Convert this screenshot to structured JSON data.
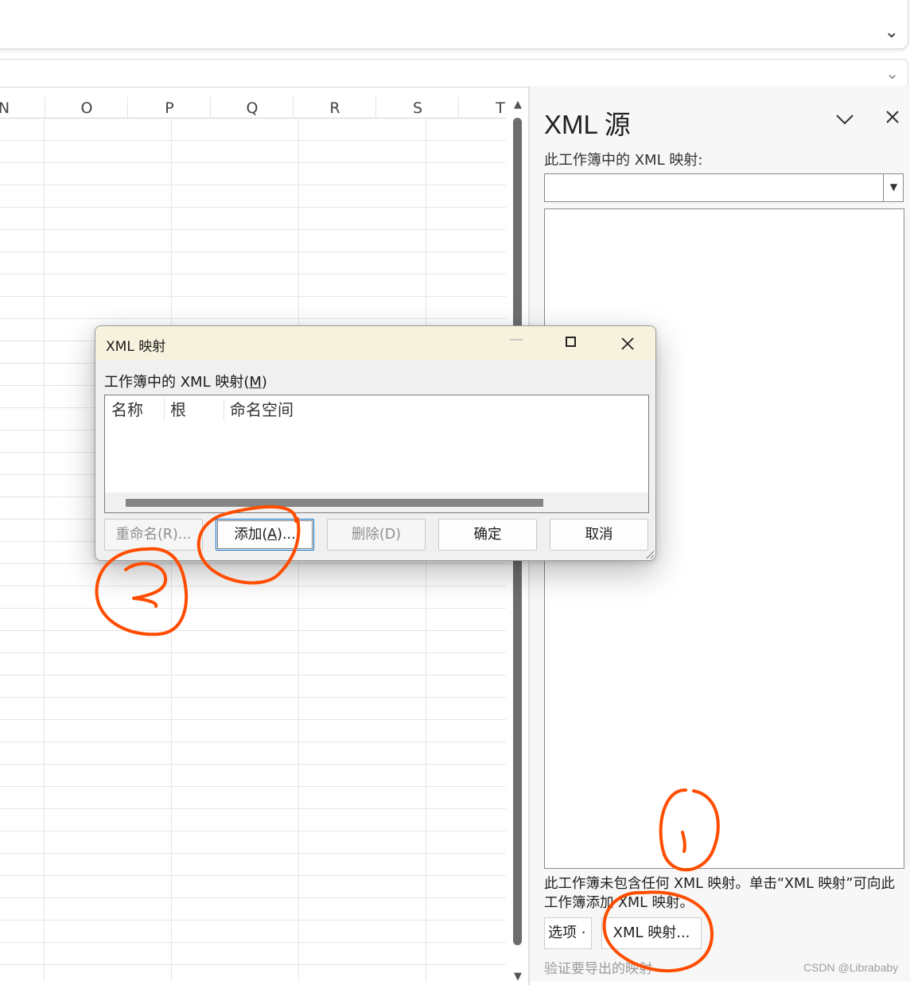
{
  "ribbon": {
    "collapse_icon": "chevron-down-icon"
  },
  "formula_bar": {
    "expand_icon": "chevron-down-icon"
  },
  "grid": {
    "columns": [
      "N",
      "O",
      "P",
      "Q",
      "R",
      "S",
      "T"
    ]
  },
  "xml_source_pane": {
    "title": "XML 源",
    "maps_label": "此工作簿中的 XML 映射:",
    "maps_selected": "",
    "hint": "此工作簿未包含任何 XML 映射。单击“XML 映射”可向此工作簿添加 XML 映射。",
    "options_label": "选项 ·",
    "xml_maps_button": "XML 映射...",
    "verify_link": "验证要导出的映射"
  },
  "dialog": {
    "title": "XML 映射",
    "list_label": "工作簿中的 XML 映射(",
    "list_label_key": "M",
    "list_label_end": ")",
    "columns": [
      "名称",
      "根",
      "命名空间"
    ],
    "buttons": {
      "rename": "重命名(R)...",
      "add_prefix": "添加(",
      "add_key": "A",
      "add_suffix": ")...",
      "delete": "删除(D)",
      "ok": "确定",
      "cancel": "取消"
    }
  },
  "annotations": {
    "color": "#ff4d00",
    "marks": [
      "①",
      "②"
    ]
  },
  "watermark": "CSDN @Librababy",
  "accent_color": "#0067c0"
}
